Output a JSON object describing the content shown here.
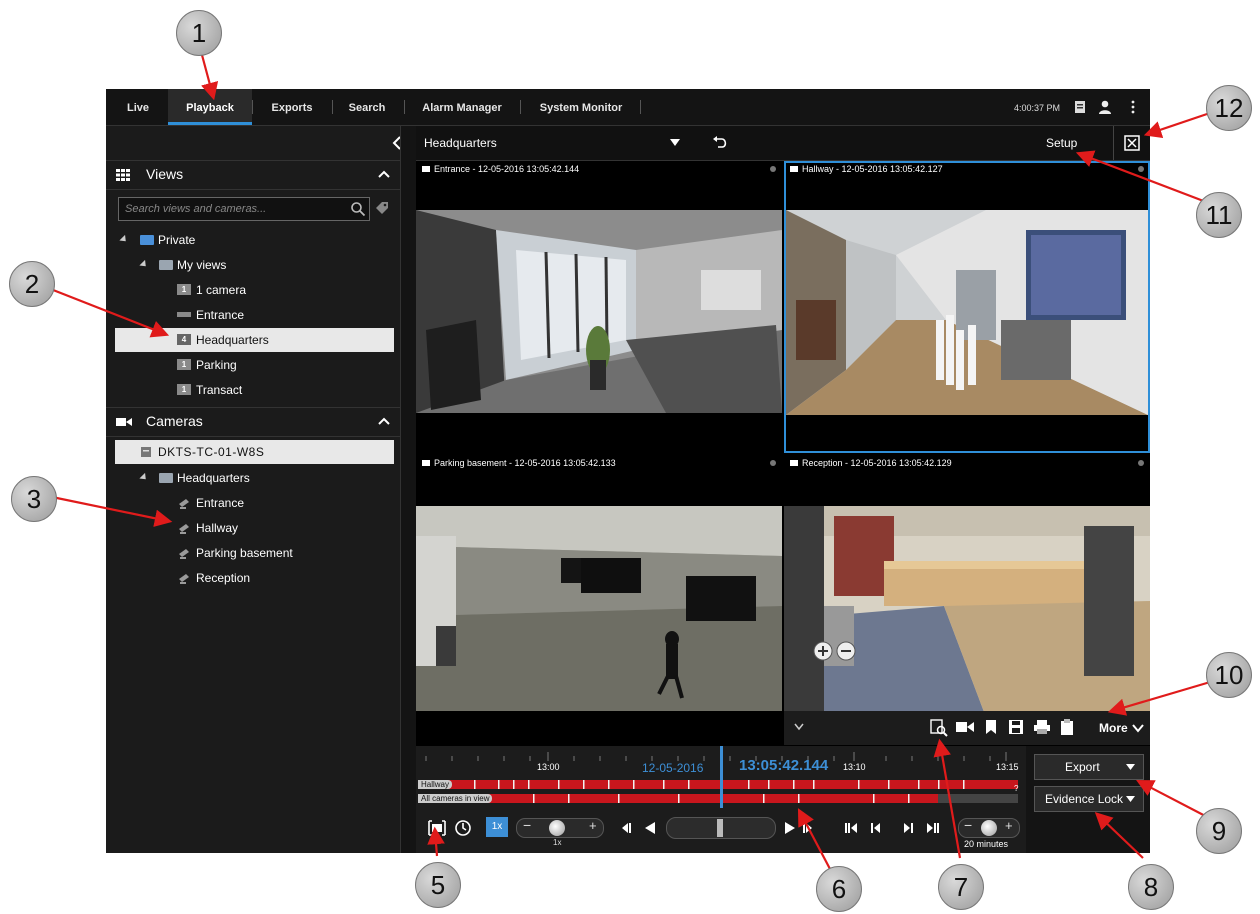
{
  "nav": {
    "tabs": [
      "Live",
      "Playback",
      "Exports",
      "Search",
      "Alarm Manager",
      "System Monitor"
    ],
    "active_tab": "Playback",
    "clock": "4:00:37 PM"
  },
  "sidebar": {
    "views_title": "Views",
    "search_placeholder": "Search views and cameras...",
    "tree": {
      "private": "Private",
      "my_views": "My views",
      "items": [
        {
          "badge": "1",
          "label": "1 camera"
        },
        {
          "badge": "",
          "label": "Entrance"
        },
        {
          "badge": "4",
          "label": "Headquarters"
        },
        {
          "badge": "1",
          "label": "Parking"
        },
        {
          "badge": "1",
          "label": "Transact"
        }
      ]
    },
    "cameras_title": "Cameras",
    "server": "DKTS-TC-01-W8S",
    "cam_group": "Headquarters",
    "cameras": [
      "Entrance",
      "Hallway",
      "Parking basement",
      "Reception"
    ]
  },
  "main": {
    "view_name": "Headquarters",
    "setup_label": "Setup",
    "tiles": [
      {
        "title": "Entrance - 12-05-2016 13:05:42.144"
      },
      {
        "title": "Hallway - 12-05-2016 13:05:42.127"
      },
      {
        "title": "Parking basement - 12-05-2016 13:05:42.133"
      },
      {
        "title": "Reception - 12-05-2016 13:05:42.129"
      }
    ],
    "tile_toolbar_more": "More"
  },
  "timeline": {
    "ticks": [
      "13:00",
      "13:10",
      "13:15"
    ],
    "date": "12-05-2016",
    "time": "13:05:42.144",
    "tracks": [
      "Hallway",
      "All cameras in view"
    ],
    "help": "?",
    "speed_label": "1x",
    "speed_value": "1x",
    "span_label": "20 minutes",
    "export_label": "Export",
    "evidence_label": "Evidence Lock"
  },
  "callouts": [
    "1",
    "2",
    "3",
    "5",
    "6",
    "7",
    "8",
    "9",
    "10",
    "11",
    "12"
  ],
  "colors": {
    "accent": "#2f8fd8",
    "track_red": "#c8161d",
    "callout_arrow": "#e01b1b"
  }
}
